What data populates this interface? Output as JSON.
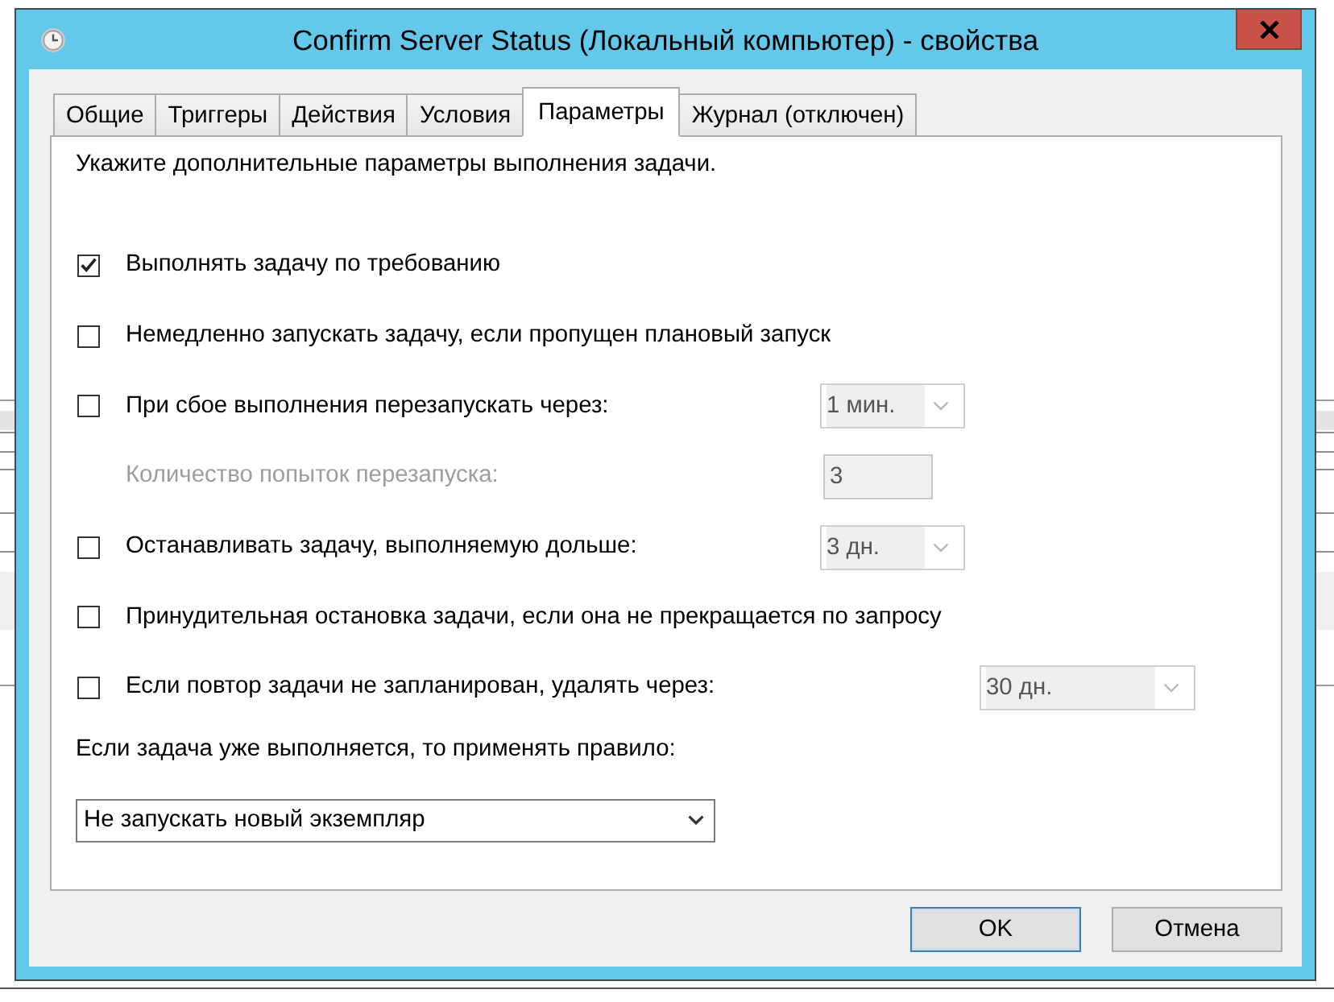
{
  "window": {
    "title": "Confirm Server Status (Локальный компьютер) - свойства"
  },
  "tabs": [
    {
      "label": "Общие",
      "selected": false
    },
    {
      "label": "Триггеры",
      "selected": false
    },
    {
      "label": "Действия",
      "selected": false
    },
    {
      "label": "Условия",
      "selected": false
    },
    {
      "label": "Параметры",
      "selected": true
    },
    {
      "label": "Журнал (отключен)",
      "selected": false
    }
  ],
  "settings": {
    "instruction": "Укажите дополнительные параметры выполнения задачи.",
    "options": [
      {
        "kind": "checkbox",
        "label": "Выполнять задачу по требованию",
        "checked": true
      },
      {
        "kind": "checkbox",
        "label": "Немедленно запускать задачу, если пропущен плановый запуск",
        "checked": false
      },
      {
        "kind": "checkbox",
        "label": "При сбое выполнения перезапускать через:",
        "checked": false,
        "control": {
          "kind": "combo",
          "value": "1 мин.",
          "disabled": true
        }
      },
      {
        "kind": "label",
        "label": "Количество попыток перезапуска:",
        "disabled": true,
        "control": {
          "kind": "field",
          "value": "3",
          "disabled": true
        }
      },
      {
        "kind": "checkbox",
        "label": "Останавливать задачу, выполняемую дольше:",
        "checked": false,
        "control": {
          "kind": "combo",
          "value": "3 дн.",
          "disabled": true
        }
      },
      {
        "kind": "checkbox",
        "label": "Принудительная остановка задачи, если она не прекращается по запросу",
        "checked": false
      },
      {
        "kind": "checkbox",
        "label": "Если повтор задачи не запланирован, удалять через:",
        "checked": false,
        "control": {
          "kind": "combo",
          "value": "30 дн.",
          "disabled": true
        }
      }
    ],
    "rule_label": "Если задача уже выполняется, то применять правило:",
    "rule_select": {
      "value": "Не запускать новый экземпляр",
      "disabled": false
    }
  },
  "buttons": [
    {
      "label": "OK",
      "default": true
    },
    {
      "label": "Отмена",
      "default": false
    }
  ]
}
